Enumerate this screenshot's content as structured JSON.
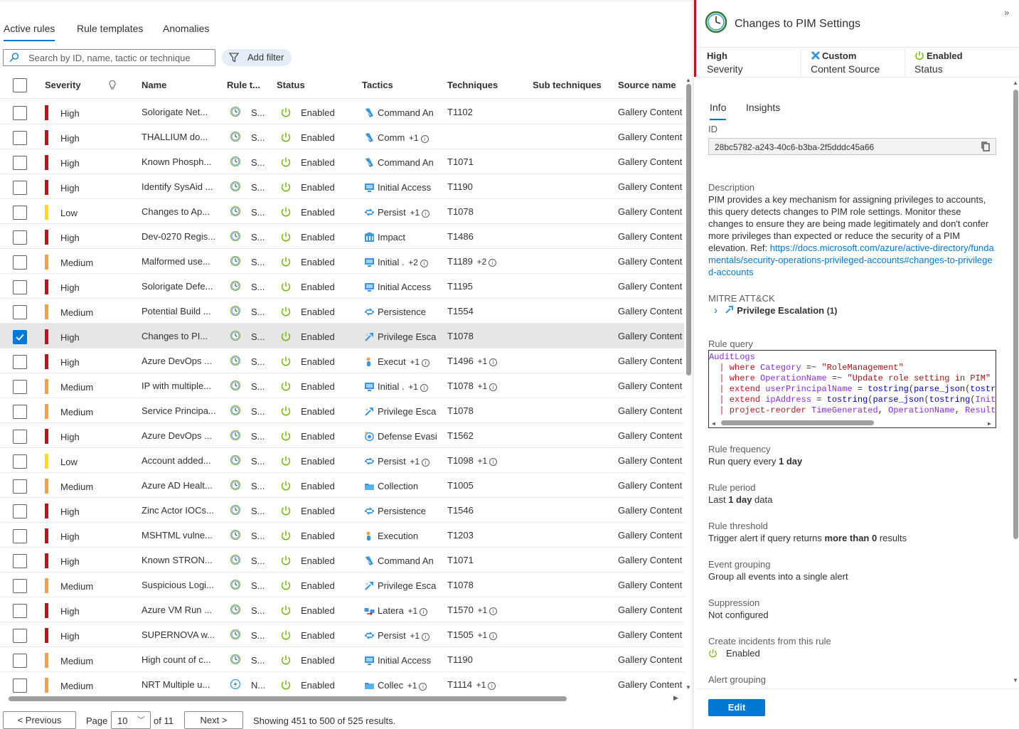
{
  "tabs": [
    "Active rules",
    "Rule templates",
    "Anomalies"
  ],
  "search": {
    "placeholder": "Search by ID, name, tactic or technique"
  },
  "add_filter": "Add filter",
  "columns": {
    "severity": "Severity",
    "name": "Name",
    "rule_type": "Rule t...",
    "status": "Status",
    "tactics": "Tactics",
    "techniques": "Techniques",
    "sub_techniques": "Sub techniques",
    "source_name": "Source name"
  },
  "colors": {
    "High": "#c50f1f",
    "Medium": "#f7a239",
    "Low": "#fce100",
    "accent": "#0078d4",
    "enabled": "#6bb700"
  },
  "rows": [
    {
      "severity": "High",
      "name": "Solorigate Net...",
      "rtype": "S...",
      "rtype_icon": "clock-icon",
      "status": "Enabled",
      "tactic": "Command An",
      "tactic_plus": "",
      "tactic_icon": "command-control-icon",
      "technique": "T1102",
      "tech_plus": "",
      "source": "Gallery Content",
      "selected": false
    },
    {
      "severity": "High",
      "name": "THALLIUM do...",
      "rtype": "S...",
      "rtype_icon": "clock-icon",
      "status": "Enabled",
      "tactic": "Comm",
      "tactic_plus": "+1",
      "tactic_icon": "command-control-icon",
      "technique": "",
      "tech_plus": "",
      "source": "Gallery Content",
      "selected": false
    },
    {
      "severity": "High",
      "name": "Known Phosph...",
      "rtype": "S...",
      "rtype_icon": "clock-icon",
      "status": "Enabled",
      "tactic": "Command An",
      "tactic_plus": "",
      "tactic_icon": "command-control-icon",
      "technique": "T1071",
      "tech_plus": "",
      "source": "Gallery Content",
      "selected": false
    },
    {
      "severity": "High",
      "name": "Identify SysAid ...",
      "rtype": "S...",
      "rtype_icon": "clock-icon",
      "status": "Enabled",
      "tactic": "Initial Access",
      "tactic_plus": "",
      "tactic_icon": "initial-access-icon",
      "technique": "T1190",
      "tech_plus": "",
      "source": "Gallery Content",
      "selected": false
    },
    {
      "severity": "Low",
      "name": "Changes to Ap...",
      "rtype": "S...",
      "rtype_icon": "clock-icon",
      "status": "Enabled",
      "tactic": "Persist",
      "tactic_plus": "+1",
      "tactic_icon": "persistence-icon",
      "technique": "T1078",
      "tech_plus": "",
      "source": "Gallery Content",
      "selected": false
    },
    {
      "severity": "High",
      "name": "Dev-0270 Regis...",
      "rtype": "S...",
      "rtype_icon": "clock-icon",
      "status": "Enabled",
      "tactic": "Impact",
      "tactic_plus": "",
      "tactic_icon": "impact-icon",
      "technique": "T1486",
      "tech_plus": "",
      "source": "Gallery Content",
      "selected": false
    },
    {
      "severity": "Medium",
      "name": "Malformed use...",
      "rtype": "S...",
      "rtype_icon": "clock-icon",
      "status": "Enabled",
      "tactic": "Initial .",
      "tactic_plus": "+2",
      "tactic_icon": "initial-access-icon",
      "technique": "T1189",
      "tech_plus": "+2",
      "source": "Gallery Content",
      "selected": false
    },
    {
      "severity": "High",
      "name": "Solorigate Defe...",
      "rtype": "S...",
      "rtype_icon": "clock-icon",
      "status": "Enabled",
      "tactic": "Initial Access",
      "tactic_plus": "",
      "tactic_icon": "initial-access-icon",
      "technique": "T1195",
      "tech_plus": "",
      "source": "Gallery Content",
      "selected": false
    },
    {
      "severity": "Medium",
      "name": "Potential Build ...",
      "rtype": "S...",
      "rtype_icon": "clock-icon",
      "status": "Enabled",
      "tactic": "Persistence",
      "tactic_plus": "",
      "tactic_icon": "persistence-icon",
      "technique": "T1554",
      "tech_plus": "",
      "source": "Gallery Content",
      "selected": false
    },
    {
      "severity": "High",
      "name": "Changes to PI...",
      "rtype": "S...",
      "rtype_icon": "clock-icon",
      "status": "Enabled",
      "tactic": "Privilege Esca",
      "tactic_plus": "",
      "tactic_icon": "privilege-escalation-icon",
      "technique": "T1078",
      "tech_plus": "",
      "source": "Gallery Content",
      "selected": true
    },
    {
      "severity": "High",
      "name": "Azure DevOps ...",
      "rtype": "S...",
      "rtype_icon": "clock-icon",
      "status": "Enabled",
      "tactic": "Execut",
      "tactic_plus": "+1",
      "tactic_icon": "execution-icon",
      "technique": "T1496",
      "tech_plus": "+1",
      "source": "Gallery Content",
      "selected": false
    },
    {
      "severity": "Medium",
      "name": "IP with multiple...",
      "rtype": "S...",
      "rtype_icon": "clock-icon",
      "status": "Enabled",
      "tactic": "Initial .",
      "tactic_plus": "+1",
      "tactic_icon": "initial-access-icon",
      "technique": "T1078",
      "tech_plus": "+1",
      "source": "Gallery Content",
      "selected": false
    },
    {
      "severity": "Medium",
      "name": "Service Principa...",
      "rtype": "S...",
      "rtype_icon": "clock-icon",
      "status": "Enabled",
      "tactic": "Privilege Esca",
      "tactic_plus": "",
      "tactic_icon": "privilege-escalation-icon",
      "technique": "T1078",
      "tech_plus": "",
      "source": "Gallery Content",
      "selected": false
    },
    {
      "severity": "High",
      "name": "Azure DevOps ...",
      "rtype": "S...",
      "rtype_icon": "clock-icon",
      "status": "Enabled",
      "tactic": "Defense Evasi",
      "tactic_plus": "",
      "tactic_icon": "defense-evasion-icon",
      "technique": "T1562",
      "tech_plus": "",
      "source": "Gallery Content",
      "selected": false
    },
    {
      "severity": "Low",
      "name": "Account added...",
      "rtype": "S...",
      "rtype_icon": "clock-icon",
      "status": "Enabled",
      "tactic": "Persist",
      "tactic_plus": "+1",
      "tactic_icon": "persistence-icon",
      "technique": "T1098",
      "tech_plus": "+1",
      "source": "Gallery Content",
      "selected": false
    },
    {
      "severity": "Medium",
      "name": "Azure AD Healt...",
      "rtype": "S...",
      "rtype_icon": "clock-icon",
      "status": "Enabled",
      "tactic": "Collection",
      "tactic_plus": "",
      "tactic_icon": "collection-icon",
      "technique": "T1005",
      "tech_plus": "",
      "source": "Gallery Content",
      "selected": false
    },
    {
      "severity": "High",
      "name": "Zinc Actor IOCs...",
      "rtype": "S...",
      "rtype_icon": "clock-icon",
      "status": "Enabled",
      "tactic": "Persistence",
      "tactic_plus": "",
      "tactic_icon": "persistence-icon",
      "technique": "T1546",
      "tech_plus": "",
      "source": "Gallery Content",
      "selected": false
    },
    {
      "severity": "High",
      "name": "MSHTML vulne...",
      "rtype": "S...",
      "rtype_icon": "clock-icon",
      "status": "Enabled",
      "tactic": "Execution",
      "tactic_plus": "",
      "tactic_icon": "execution-icon",
      "technique": "T1203",
      "tech_plus": "",
      "source": "Gallery Content",
      "selected": false
    },
    {
      "severity": "High",
      "name": "Known STRON...",
      "rtype": "S...",
      "rtype_icon": "clock-icon",
      "status": "Enabled",
      "tactic": "Command An",
      "tactic_plus": "",
      "tactic_icon": "command-control-icon",
      "technique": "T1071",
      "tech_plus": "",
      "source": "Gallery Content",
      "selected": false
    },
    {
      "severity": "Medium",
      "name": "Suspicious Logi...",
      "rtype": "S...",
      "rtype_icon": "clock-icon",
      "status": "Enabled",
      "tactic": "Privilege Esca",
      "tactic_plus": "",
      "tactic_icon": "privilege-escalation-icon",
      "technique": "T1078",
      "tech_plus": "",
      "source": "Gallery Content",
      "selected": false
    },
    {
      "severity": "High",
      "name": "Azure VM Run ...",
      "rtype": "S...",
      "rtype_icon": "clock-icon",
      "status": "Enabled",
      "tactic": "Latera",
      "tactic_plus": "+1",
      "tactic_icon": "lateral-movement-icon",
      "technique": "T1570",
      "tech_plus": "+1",
      "source": "Gallery Content",
      "selected": false
    },
    {
      "severity": "High",
      "name": "SUPERNOVA w...",
      "rtype": "S...",
      "rtype_icon": "clock-icon",
      "status": "Enabled",
      "tactic": "Persist",
      "tactic_plus": "+1",
      "tactic_icon": "persistence-icon",
      "technique": "T1505",
      "tech_plus": "+1",
      "source": "Gallery Content",
      "selected": false
    },
    {
      "severity": "Medium",
      "name": "High count of c...",
      "rtype": "S...",
      "rtype_icon": "clock-icon",
      "status": "Enabled",
      "tactic": "Initial Access",
      "tactic_plus": "",
      "tactic_icon": "initial-access-icon",
      "technique": "T1190",
      "tech_plus": "",
      "source": "Gallery Content",
      "selected": false
    },
    {
      "severity": "Medium",
      "name": "NRT Multiple u...",
      "rtype": "N...",
      "rtype_icon": "lightning-icon",
      "status": "Enabled",
      "tactic": "Collec",
      "tactic_plus": "+1",
      "tactic_icon": "collection-icon",
      "technique": "T1114",
      "tech_plus": "+1",
      "source": "Gallery Content",
      "selected": false
    }
  ],
  "pagination": {
    "previous": "< Previous",
    "page_label": "Page",
    "page_value": "10",
    "of_label": "of 11",
    "next": "Next >",
    "summary": "Showing 451 to 500 of 525 results."
  },
  "detail": {
    "title": "Changes to PIM Settings",
    "stats": [
      {
        "value": "High",
        "key": "Severity",
        "icon": ""
      },
      {
        "value": "Custom",
        "key": "Content Source",
        "icon": "custom-icon"
      },
      {
        "value": "Enabled",
        "key": "Status",
        "icon": "power-icon"
      }
    ],
    "tabs": [
      "Info",
      "Insights"
    ],
    "id_label": "ID",
    "id_value": "28bc5782-a243-40c6-b3ba-2f5dddc45a66",
    "description_label": "Description",
    "description_text": "PIM provides a key mechanism for assigning privileges to accounts, this query detects changes to PIM role settings. Monitor these changes to ensure they are being made legitimately and don't confer more privileges than expected or reduce the security of a PIM elevation. Ref: ",
    "description_link": "https://docs.microsoft.com/azure/active-directory/fundamentals/security-operations-privileged-accounts#changes-to-privileged-accounts",
    "mitre_label": "MITRE ATT&CK",
    "mitre_item": "Privilege Escalation",
    "mitre_count": "(1)",
    "query_label": "Rule query",
    "query_lines": [
      "AuditLogs",
      "| where Category =~ \"RoleManagement\"",
      "| where OperationName =~ \"Update role setting in PIM\"",
      "| extend userPrincipalName = tostring(parse_json(tostri",
      "| extend ipAddress = tostring(parse_json(tostring(Initi",
      "| project-reorder TimeGenerated, OperationName, Result"
    ],
    "frequency_label": "Rule frequency",
    "frequency_pre": "Run query every ",
    "frequency_bold": "1 day",
    "period_label": "Rule period",
    "period_pre": "Last ",
    "period_bold": "1 day",
    "period_post": " data",
    "threshold_label": "Rule threshold",
    "threshold_pre": "Trigger alert if query returns ",
    "threshold_bold": "more than 0",
    "threshold_post": " results",
    "grouping_label": "Event grouping",
    "grouping_value": "Group all events into a single alert",
    "suppression_label": "Suppression",
    "suppression_value": "Not configured",
    "incidents_label": "Create incidents from this rule",
    "incidents_value": "Enabled",
    "alert_grouping_label": "Alert grouping",
    "edit_button": "Edit"
  }
}
